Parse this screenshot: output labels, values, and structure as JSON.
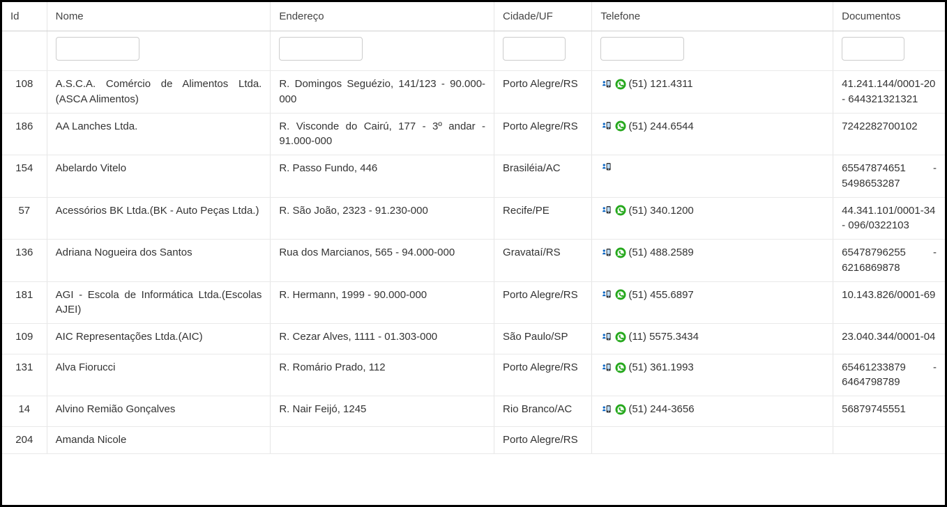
{
  "columns": {
    "id": "Id",
    "nome": "Nome",
    "endereco": "Endereço",
    "cidade": "Cidade/UF",
    "telefone": "Telefone",
    "documentos": "Documentos"
  },
  "filters": {
    "nome": "",
    "endereco": "",
    "cidade": "",
    "telefone": "",
    "documentos": ""
  },
  "rows": [
    {
      "id": "108",
      "nome": "A.S.C.A. Comércio de Alimentos Ltda.(ASCA Alimentos)",
      "endereco": "R. Domingos Seguézio, 141/123 - 90.000-000",
      "cidade": "Porto Alegre/RS",
      "has_phone_icon": true,
      "has_whatsapp_icon": true,
      "telefone": "(51) 121.4311",
      "documentos": "41.241.144/0001-20 - 644321321321"
    },
    {
      "id": "186",
      "nome": "AA Lanches Ltda.",
      "endereco": "R. Visconde do Cairú, 177 - 3º andar - 91.000-000",
      "cidade": "Porto Alegre/RS",
      "has_phone_icon": true,
      "has_whatsapp_icon": true,
      "telefone": "(51) 244.6544",
      "documentos": "7242282700102"
    },
    {
      "id": "154",
      "nome": "Abelardo Vitelo",
      "endereco": "R. Passo Fundo, 446",
      "cidade": "Brasiléia/AC",
      "has_phone_icon": true,
      "has_whatsapp_icon": false,
      "telefone": "",
      "documentos": "65547874651 - 5498653287"
    },
    {
      "id": "57",
      "nome": "Acessórios BK Ltda.(BK - Auto Peças Ltda.)",
      "endereco": "R. São João, 2323 - 91.230-000",
      "cidade": "Recife/PE",
      "has_phone_icon": true,
      "has_whatsapp_icon": true,
      "telefone": "(51) 340.1200",
      "documentos": "44.341.101/0001-34 - 096/0322103"
    },
    {
      "id": "136",
      "nome": "Adriana Nogueira dos Santos",
      "endereco": "Rua dos Marcianos, 565 - 94.000-000",
      "cidade": "Gravataí/RS",
      "has_phone_icon": true,
      "has_whatsapp_icon": true,
      "telefone": "(51) 488.2589",
      "documentos": "65478796255 - 6216869878"
    },
    {
      "id": "181",
      "nome": "AGI - Escola de Informática Ltda.(Escolas AJEI)",
      "endereco": "R. Hermann, 1999 - 90.000-000",
      "cidade": "Porto Alegre/RS",
      "has_phone_icon": true,
      "has_whatsapp_icon": true,
      "telefone": "(51) 455.6897",
      "documentos": "10.143.826/0001-69"
    },
    {
      "id": "109",
      "nome": "AIC Representações Ltda.(AIC)",
      "endereco": "R. Cezar Alves, 1111 - 01.303-000",
      "cidade": "São Paulo/SP",
      "has_phone_icon": true,
      "has_whatsapp_icon": true,
      "telefone": "(11) 5575.3434",
      "documentos": "23.040.344/0001-04"
    },
    {
      "id": "131",
      "nome": "Alva Fiorucci",
      "endereco": "R. Romário Prado, 112",
      "cidade": "Porto Alegre/RS",
      "has_phone_icon": true,
      "has_whatsapp_icon": true,
      "telefone": "(51) 361.1993",
      "documentos": "65461233879 - 6464798789"
    },
    {
      "id": "14",
      "nome": "Alvino Remião Gonçalves",
      "endereco": "R. Nair Feijó, 1245",
      "cidade": "Rio Branco/AC",
      "has_phone_icon": true,
      "has_whatsapp_icon": true,
      "telefone": "(51) 244-3656",
      "documentos": "56879745551"
    },
    {
      "id": "204",
      "nome": "Amanda Nicole",
      "endereco": "",
      "cidade": "Porto Alegre/RS",
      "has_phone_icon": false,
      "has_whatsapp_icon": false,
      "telefone": "",
      "documentos": ""
    }
  ]
}
